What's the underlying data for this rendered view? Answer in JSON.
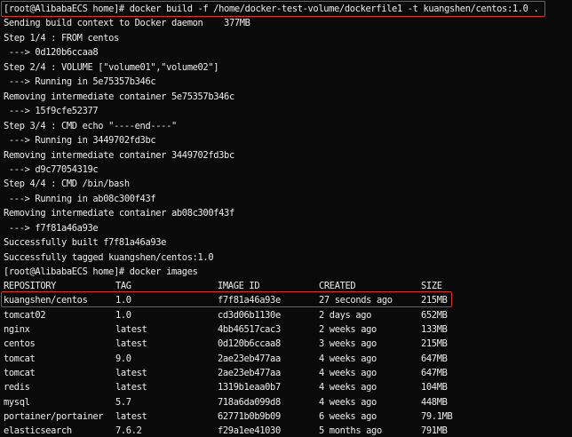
{
  "terminal": {
    "build_output": [
      "[root@AlibabaECS home]# docker build -f /home/docker-test-volume/dockerfile1 -t kuangshen/centos:1.0 .",
      "Sending build context to Docker daemon    377MB",
      "Step 1/4 : FROM centos",
      " ---> 0d120b6ccaa8",
      "Step 2/4 : VOLUME [\"volume01\",\"volume02\"]",
      " ---> Running in 5e75357b346c",
      "Removing intermediate container 5e75357b346c",
      " ---> 15f9cfe52377",
      "Step 3/4 : CMD echo \"----end----\"",
      " ---> Running in 3449702fd3bc",
      "Removing intermediate container 3449702fd3bc",
      " ---> d9c77054319c",
      "Step 4/4 : CMD /bin/bash",
      " ---> Running in ab08c300f43f",
      "Removing intermediate container ab08c300f43f",
      " ---> f7f81a46a93e",
      "Successfully built f7f81a46a93e",
      "Successfully tagged kuangshen/centos:1.0",
      "[root@AlibabaECS home]# docker images"
    ],
    "images_table": {
      "headers": [
        "REPOSITORY",
        "TAG",
        "IMAGE ID",
        "CREATED",
        "SIZE"
      ],
      "rows": [
        [
          "kuangshen/centos",
          "1.0",
          "f7f81a46a93e",
          "27 seconds ago",
          "215MB"
        ],
        [
          "tomcat02",
          "1.0",
          "cd3d06b1130e",
          "2 days ago",
          "652MB"
        ],
        [
          "nginx",
          "latest",
          "4bb46517cac3",
          "2 weeks ago",
          "133MB"
        ],
        [
          "centos",
          "latest",
          "0d120b6ccaa8",
          "3 weeks ago",
          "215MB"
        ],
        [
          "tomcat",
          "9.0",
          "2ae23eb477aa",
          "4 weeks ago",
          "647MB"
        ],
        [
          "tomcat",
          "latest",
          "2ae23eb477aa",
          "4 weeks ago",
          "647MB"
        ],
        [
          "redis",
          "latest",
          "1319b1eaa0b7",
          "4 weeks ago",
          "104MB"
        ],
        [
          "mysql",
          "5.7",
          "718a6da099d8",
          "4 weeks ago",
          "448MB"
        ],
        [
          "portainer/portainer",
          "latest",
          "62771b0b9b09",
          "6 weeks ago",
          "79.1MB"
        ],
        [
          "elasticsearch",
          "7.6.2",
          "f29a1ee41030",
          "5 months ago",
          "791MB"
        ]
      ]
    },
    "highlight_color": "#d9342b",
    "text_color": "#ececec",
    "background_color": "#0a0a0a"
  }
}
